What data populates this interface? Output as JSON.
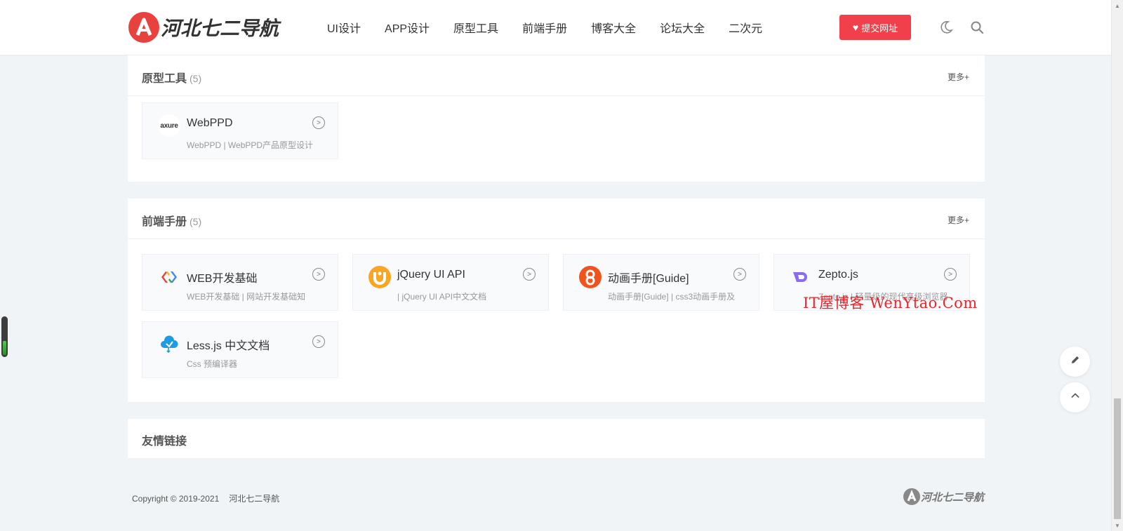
{
  "header": {
    "logo_text": "河北七二导航",
    "nav": [
      "UI设计",
      "APP设计",
      "原型工具",
      "前端手册",
      "博客大全",
      "论坛大全",
      "二次元"
    ],
    "submit_label": "提交网址",
    "icons": [
      "moon-icon",
      "search-icon"
    ],
    "accent": "#f1404b"
  },
  "sections": {
    "prototype": {
      "title": "原型工具",
      "count": "(5)",
      "more": "更多+",
      "cards": [
        {
          "name": "WebPPD",
          "desc": "WebPPD | WebPPD产品原型设计",
          "icon": "axure-logo",
          "icon_text": "axure"
        }
      ]
    },
    "frontend": {
      "title": "前端手册",
      "count": "(5)",
      "more": "更多+",
      "cards": [
        {
          "name": "WEB开发基础",
          "desc": "WEB开发基础 | 网站开发基础知",
          "icon": "google-web-logo"
        },
        {
          "name": "jQuery UI API",
          "desc": "| jQuery UI API中文文档",
          "icon": "jquery-ui-logo"
        },
        {
          "name": "动画手册[Guide]",
          "desc": "动画手册[Guide] | css3动画手册及",
          "icon": "animate-logo"
        },
        {
          "name": "Zepto.js",
          "desc": "Zepto.js | 轻量级的现代高级浏览器",
          "icon": "zepto-logo"
        },
        {
          "name": "Less.js 中文文档",
          "desc": "Css 预编译器",
          "icon": "less-logo"
        }
      ]
    },
    "links": {
      "title": "友情链接"
    }
  },
  "watermark": "IT屋博客 WenYtao.Com",
  "footer": {
    "copyright": "Copyright © 2019-2021",
    "site_name": "河北七二导航",
    "logo_text": "河北七二导航"
  }
}
